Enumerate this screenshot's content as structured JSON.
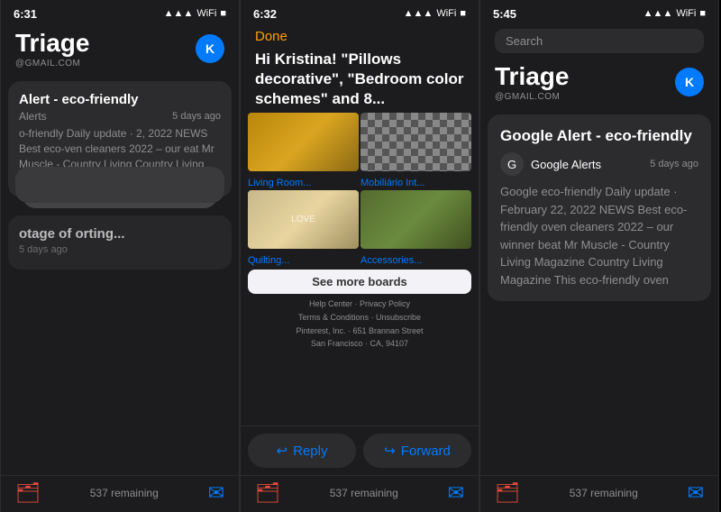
{
  "phone1": {
    "status": {
      "time": "6:31",
      "signal": "📶",
      "wifi": "wifi",
      "battery": "🔋"
    },
    "header": {
      "title": "Triage",
      "gmail": "@GMAIL.COM",
      "avatar": "K"
    },
    "card1": {
      "subject": "Alert - eco-friendly",
      "sender": "Alerts",
      "date": "5 days ago",
      "preview": "o-friendly Daily update · 2, 2022 NEWS Best eco-ven cleaners 2022 – our eat Mr Muscle - Country Living Country Living Magazine friendly oven"
    },
    "card2": {
      "subject": "otage of orting...",
      "date": "5 days ago"
    },
    "tab": {
      "remaining": "537 remaining"
    }
  },
  "phone2": {
    "status": {
      "time": "6:32"
    },
    "done": "Done",
    "subject": "Hi Kristina! \"Pillows decorative\", \"Bedroom color schemes\" and 8...",
    "boards": {
      "label1": "Living Room...",
      "label2": "Mobiliário Int...",
      "label3": "Quilting...",
      "label4": "Accessories...",
      "see_more": "See more boards"
    },
    "footer": {
      "links": "Help Center · Privacy Policy\nTerms & Conditions · Unsubscribe",
      "address": "Pinterest, Inc. · 651 Brannan Street\nSan Francisco · CA, 94107"
    },
    "actions": {
      "reply": "Reply",
      "forward": "Forward"
    },
    "tab": {
      "remaining": "537 remaining"
    }
  },
  "phone3": {
    "status": {
      "time": "5:45",
      "search_label": "Search"
    },
    "header": {
      "title": "Triage",
      "gmail": "@GMAIL.COM",
      "avatar": "K"
    },
    "detail_card": {
      "subject": "Google Alert - eco-friendly",
      "sender_icon": "G",
      "sender_name": "Google Alerts",
      "date": "5 days ago",
      "body": "Google eco-friendly Daily update · February 22, 2022 NEWS Best eco-friendly oven cleaners 2022 – our winner beat Mr Muscle - Country Living Magazine Country Living Magazine This eco-friendly oven"
    },
    "tab": {
      "remaining": "537 remaining"
    }
  },
  "icons": {
    "archive": "🗂",
    "inbox": "✉",
    "reply_arrow": "↩",
    "forward_arrow": "↪",
    "signal": "▲▲▲",
    "wifi_sym": "((·))",
    "bat_sym": "▮"
  }
}
